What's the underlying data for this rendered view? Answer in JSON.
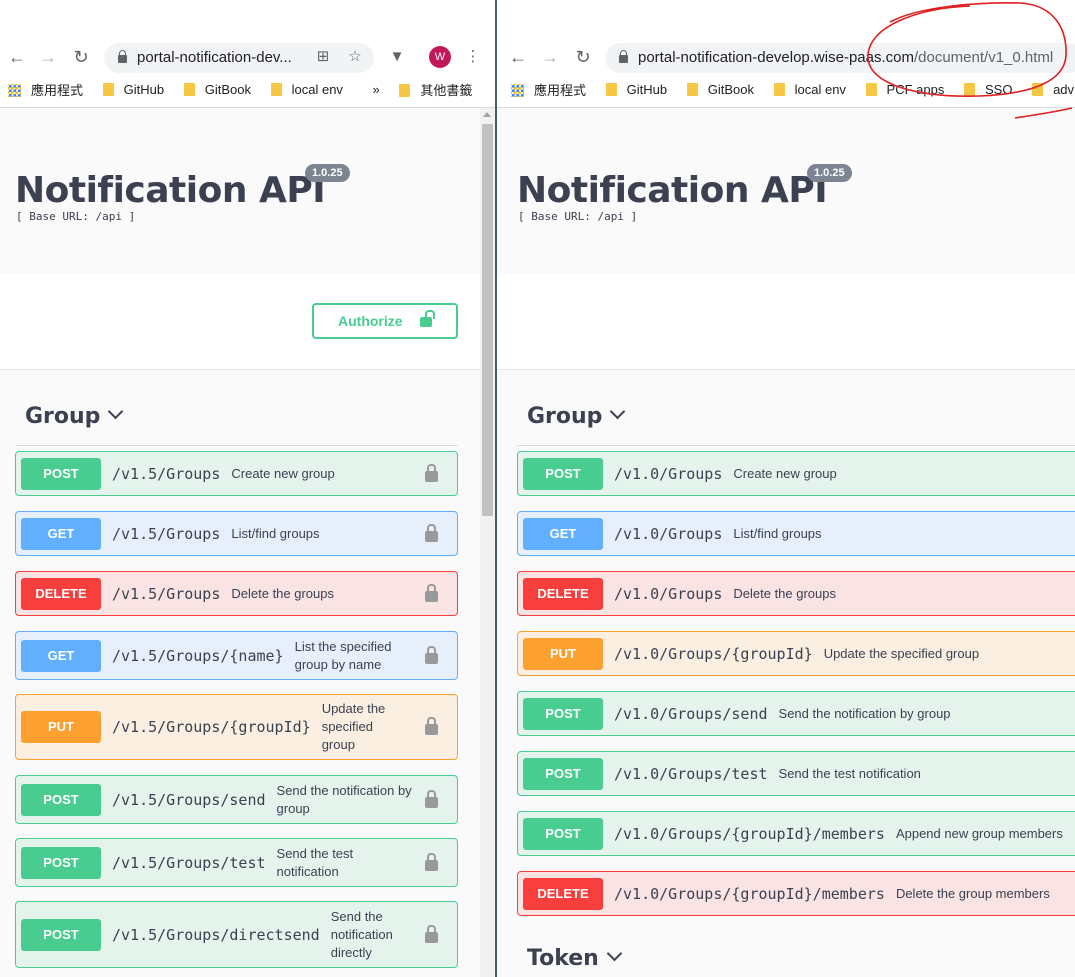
{
  "browser_left": {
    "url": "portal-notification-dev...",
    "bookmarks": [
      "應用程式",
      "GitHub",
      "GitBook",
      "local env"
    ],
    "more_label": "»",
    "other_bookmarks": "其他書籤",
    "avatar_letter": "W"
  },
  "browser_right": {
    "url_host": "portal-notification-develop.wise-paas.com",
    "url_path": "/document/v1_0.html",
    "bookmarks": [
      "應用程式",
      "GitHub",
      "GitBook",
      "local env",
      "PCF apps",
      "SSO",
      "adv git"
    ]
  },
  "doc": {
    "title": "Notification API",
    "version": "1.0.25",
    "base_url": "[ Base URL: /api ]",
    "authorize_label": "Authorize",
    "group_tag": "Group",
    "token_tag": "Token"
  },
  "left_ops": [
    {
      "method": "POST",
      "path": "/v1.5/Groups",
      "summary": "Create new group"
    },
    {
      "method": "GET",
      "path": "/v1.5/Groups",
      "summary": "List/find groups"
    },
    {
      "method": "DELETE",
      "path": "/v1.5/Groups",
      "summary": "Delete the groups"
    },
    {
      "method": "GET",
      "path": "/v1.5/Groups/{name}",
      "summary": "List the specified group by name"
    },
    {
      "method": "PUT",
      "path": "/v1.5/Groups/{groupId}",
      "summary": "Update the specified group"
    },
    {
      "method": "POST",
      "path": "/v1.5/Groups/send",
      "summary": "Send the notification by group"
    },
    {
      "method": "POST",
      "path": "/v1.5/Groups/test",
      "summary": "Send the test notification"
    },
    {
      "method": "POST",
      "path": "/v1.5/Groups/directsend",
      "summary": "Send the notification directly"
    }
  ],
  "right_ops": [
    {
      "method": "POST",
      "path": "/v1.0/Groups",
      "summary": "Create new group"
    },
    {
      "method": "GET",
      "path": "/v1.0/Groups",
      "summary": "List/find groups"
    },
    {
      "method": "DELETE",
      "path": "/v1.0/Groups",
      "summary": "Delete the groups"
    },
    {
      "method": "PUT",
      "path": "/v1.0/Groups/{groupId}",
      "summary": "Update the specified group"
    },
    {
      "method": "POST",
      "path": "/v1.0/Groups/send",
      "summary": "Send the notification by group"
    },
    {
      "method": "POST",
      "path": "/v1.0/Groups/test",
      "summary": "Send the test notification"
    },
    {
      "method": "POST",
      "path": "/v1.0/Groups/{groupId}/members",
      "summary": "Append new group members"
    },
    {
      "method": "DELETE",
      "path": "/v1.0/Groups/{groupId}/members",
      "summary": "Delete the group members"
    }
  ],
  "colors": {
    "post": "#49cc90",
    "get": "#61affe",
    "delete": "#f93e3e",
    "put": "#fca130",
    "annotation": "#e02020"
  },
  "icons": [
    "back-icon",
    "forward-icon",
    "reload-icon",
    "lock-icon",
    "translate-icon",
    "star-icon",
    "vuetify-icon",
    "menu-icon",
    "folder-icon",
    "apps-icon",
    "lock-icon",
    "chevron-down-icon"
  ]
}
